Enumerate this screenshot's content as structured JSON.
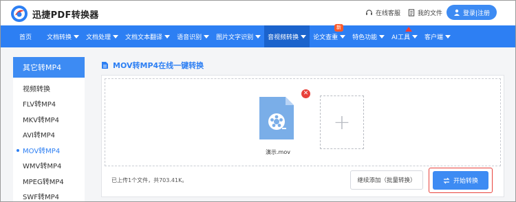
{
  "header": {
    "brand": "迅捷PDF转换器",
    "customer_service": "在线客服",
    "my_files": "我的文件",
    "login": "登录|注册"
  },
  "nav": {
    "items": [
      {
        "label": "首页",
        "dropdown": false
      },
      {
        "label": "文档转换",
        "dropdown": true
      },
      {
        "label": "文档处理",
        "dropdown": true
      },
      {
        "label": "文档文本翻译",
        "dropdown": true
      },
      {
        "label": "语音识别",
        "dropdown": true
      },
      {
        "label": "图片文字识别",
        "dropdown": true
      },
      {
        "label": "音视频转换",
        "dropdown": true,
        "active": true
      },
      {
        "label": "论文查重",
        "dropdown": true
      },
      {
        "label": "特色功能",
        "dropdown": true
      },
      {
        "label": "AI工具",
        "dropdown": true
      },
      {
        "label": "客户端",
        "dropdown": true
      }
    ],
    "badge": "新"
  },
  "sidebar": {
    "title": "其它转MP4",
    "items": [
      {
        "label": "视频转换"
      },
      {
        "label": "FLV转MP4"
      },
      {
        "label": "MKV转MP4"
      },
      {
        "label": "AVI转MP4"
      },
      {
        "label": "MOV转MP4",
        "active": true
      },
      {
        "label": "WMV转MP4"
      },
      {
        "label": "MPEG转MP4"
      },
      {
        "label": "SWF转MP4"
      }
    ]
  },
  "main": {
    "title": "MOV转MP4在线一键转换",
    "file_name": "演示.mov",
    "status": "已上传1个文件，共703.41K。",
    "continue_label": "继续添加（批量转换）",
    "start_label": "开始转换"
  },
  "colors": {
    "primary": "#2d7ff3",
    "nav_active": "#1b63cc",
    "button": "#3d8bf3",
    "highlight": "#e8413a",
    "badge": "#ff5b2a",
    "file_icon": "#7aaee8"
  }
}
